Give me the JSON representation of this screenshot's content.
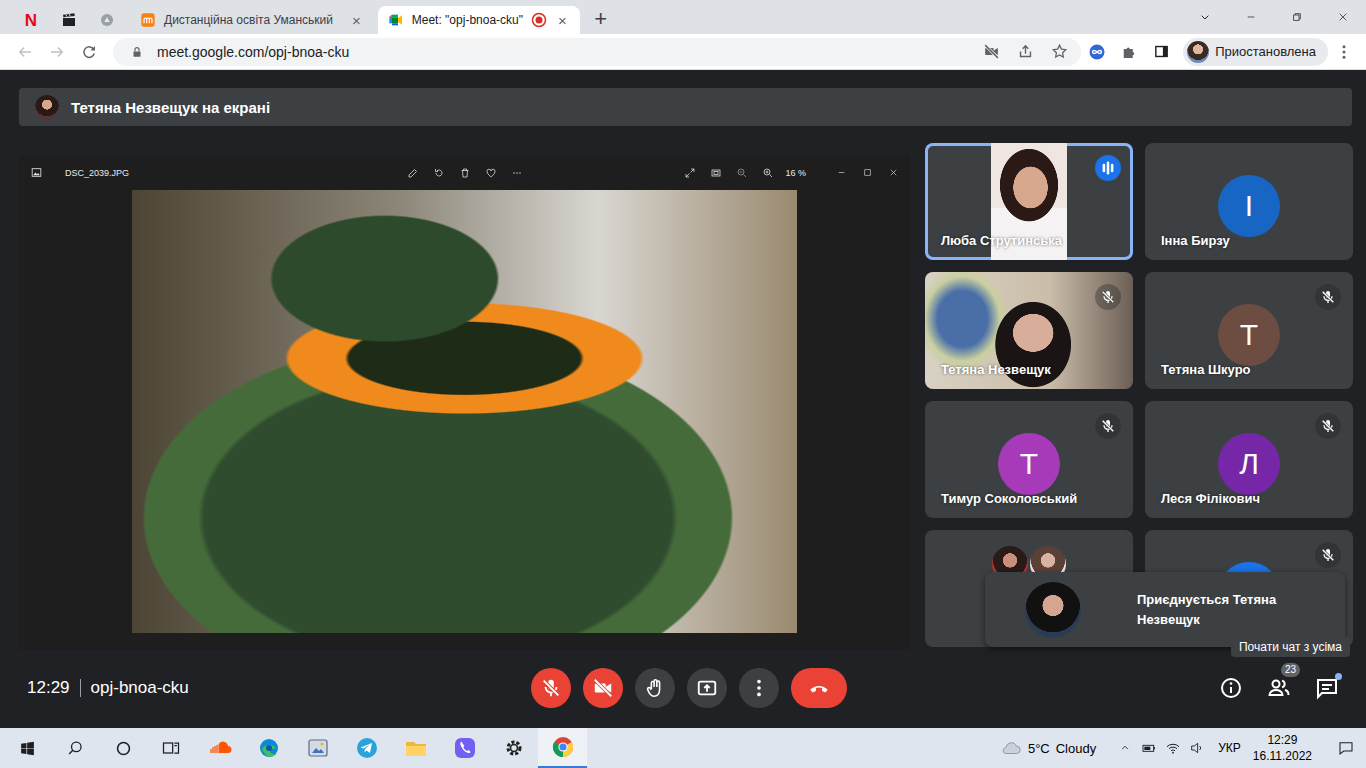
{
  "browser": {
    "pinned_tabs": [
      {
        "kind": "netflix",
        "label": "N"
      },
      {
        "kind": "clapper"
      },
      {
        "kind": "app"
      }
    ],
    "tabs": [
      {
        "label": "Дистанційна освіта Уманський",
        "kind": "moodle",
        "close": "×",
        "selected": false,
        "recording": false
      },
      {
        "label": "Meet: \"opj-bnoa-cku\"",
        "kind": "meet",
        "close": "×",
        "selected": true,
        "recording": true
      }
    ],
    "new_tab": "+",
    "url": "meet.google.com/opj-bnoa-cku",
    "profile": "Приостановлена"
  },
  "meet": {
    "banner": "Тетяна Незвещук на екрані",
    "viewer": {
      "filename": "DSC_2039.JPG",
      "zoom": "16 %"
    },
    "participants": [
      {
        "name": "Люба Струтинська",
        "kind": "portrait-video",
        "muted": false,
        "speaking": true,
        "selected": true
      },
      {
        "name": "Інна Бирзу",
        "kind": "avatar",
        "initial": "І",
        "color": "#1766c4",
        "muted": false,
        "speaking": false,
        "selected": false
      },
      {
        "name": "Тетяна Незвещук",
        "kind": "video",
        "muted": true,
        "speaking": false,
        "selected": false
      },
      {
        "name": "Тетяна Шкуро",
        "kind": "avatar",
        "initial": "Т",
        "color": "#6d4c41",
        "muted": true,
        "speaking": false,
        "selected": false
      },
      {
        "name": "Тимур Соколовський",
        "kind": "avatar",
        "initial": "Т",
        "color": "#a63ab8",
        "muted": true,
        "speaking": false,
        "selected": false
      },
      {
        "name": "Леся Філікович",
        "kind": "avatar",
        "initial": "Л",
        "color": "#7627a8",
        "muted": true,
        "speaking": false,
        "selected": false
      },
      {
        "kind": "group",
        "muted": false,
        "speaking": false,
        "selected": false
      },
      {
        "kind": "avatar",
        "color": "#1a73e8",
        "muted": true,
        "speaking": false,
        "selected": false
      }
    ],
    "notification": "Приєднується Тетяна Незвещук",
    "tooltip": "Почати чат з усіма",
    "clock": "12:29",
    "meeting_code": "opj-bnoa-cku",
    "controls": [
      {
        "kind": "mic",
        "off": true
      },
      {
        "kind": "camera",
        "off": true
      },
      {
        "kind": "hand",
        "off": false
      },
      {
        "kind": "present",
        "off": false
      },
      {
        "kind": "more",
        "off": false
      },
      {
        "kind": "leave",
        "off": false
      }
    ],
    "people_count": "23",
    "chat_unread": true
  },
  "taskbar": {
    "apps": [
      {
        "kind": "soundcloud",
        "selected": false
      },
      {
        "kind": "edge",
        "selected": false
      },
      {
        "kind": "photos",
        "selected": false
      },
      {
        "kind": "telegram",
        "selected": false
      },
      {
        "kind": "explorer",
        "selected": false
      },
      {
        "kind": "viber",
        "selected": false
      },
      {
        "kind": "settings",
        "selected": false
      },
      {
        "kind": "chrome",
        "selected": true
      }
    ],
    "weather": {
      "temp": "5°C",
      "condition": "Cloudy"
    },
    "language": "УКР",
    "time": "12:29",
    "date": "16.11.2022"
  }
}
